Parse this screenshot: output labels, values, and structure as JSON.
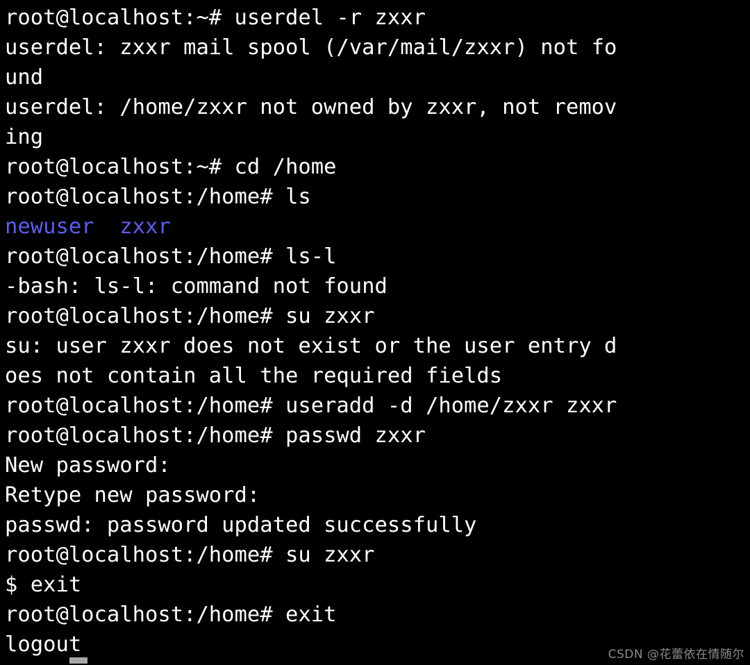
{
  "terminal": {
    "background_color": "#000000",
    "foreground_color": "#ffffff",
    "dir_color": "#5c5cf0",
    "cursor_color": "#a8a8a8",
    "lines": [
      {
        "text": "root@localhost:~# userdel -r zxxr",
        "color": "white"
      },
      {
        "text": "userdel: zxxr mail spool (/var/mail/zxxr) not fo",
        "color": "white"
      },
      {
        "text": "und",
        "color": "white"
      },
      {
        "text": "userdel: /home/zxxr not owned by zxxr, not remov",
        "color": "white"
      },
      {
        "text": "ing",
        "color": "white"
      },
      {
        "text": "root@localhost:~# cd /home",
        "color": "white"
      },
      {
        "text": "root@localhost:/home# ls",
        "color": "white"
      },
      {
        "text": "newuser  zxxr",
        "color": "blue"
      },
      {
        "text": "root@localhost:/home# ls-l",
        "color": "white"
      },
      {
        "text": "-bash: ls-l: command not found",
        "color": "white"
      },
      {
        "text": "root@localhost:/home# su zxxr",
        "color": "white"
      },
      {
        "text": "su: user zxxr does not exist or the user entry d",
        "color": "white"
      },
      {
        "text": "oes not contain all the required fields",
        "color": "white"
      },
      {
        "text": "root@localhost:/home# useradd -d /home/zxxr zxxr",
        "color": "white"
      },
      {
        "text": "root@localhost:/home# passwd zxxr",
        "color": "white"
      },
      {
        "text": "New password:",
        "color": "white"
      },
      {
        "text": "Retype new password:",
        "color": "white"
      },
      {
        "text": "passwd: password updated successfully",
        "color": "white"
      },
      {
        "text": "root@localhost:/home# su zxxr",
        "color": "white"
      },
      {
        "text": "$ exit",
        "color": "white"
      },
      {
        "text": "root@localhost:/home# exit",
        "color": "white"
      },
      {
        "text": "logout",
        "color": "white"
      }
    ]
  },
  "watermark": {
    "text": "CSDN @花蕾依在情随尔"
  }
}
